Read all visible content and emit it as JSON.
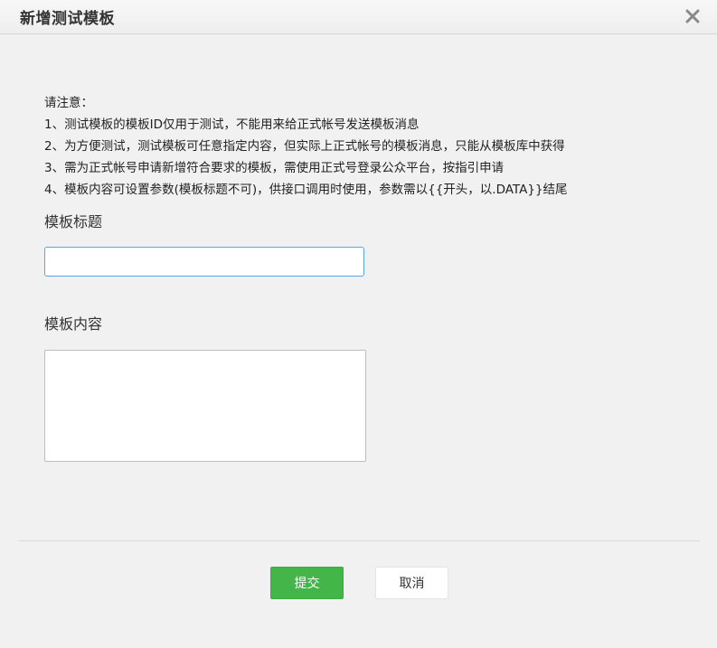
{
  "dialog": {
    "title": "新增测试模板",
    "close_icon": "close-icon"
  },
  "notice": {
    "heading": "请注意：",
    "lines": [
      "1、测试模板的模板ID仅用于测试，不能用来给正式帐号发送模板消息",
      "2、为方便测试，测试模板可任意指定内容，但实际上正式帐号的模板消息，只能从模板库中获得",
      "3、需为正式帐号申请新增符合要求的模板，需使用正式号登录公众平台，按指引申请",
      "4、模板内容可设置参数(模板标题不可)，供接口调用时使用，参数需以{{开头，以.DATA}}结尾"
    ]
  },
  "form": {
    "title_label": "模板标题",
    "title_value": "",
    "content_label": "模板内容",
    "content_value": ""
  },
  "buttons": {
    "submit": "提交",
    "cancel": "取消"
  },
  "colors": {
    "primary": "#44b549",
    "focus_border": "#59a4e8",
    "background": "#f1f1f1"
  }
}
